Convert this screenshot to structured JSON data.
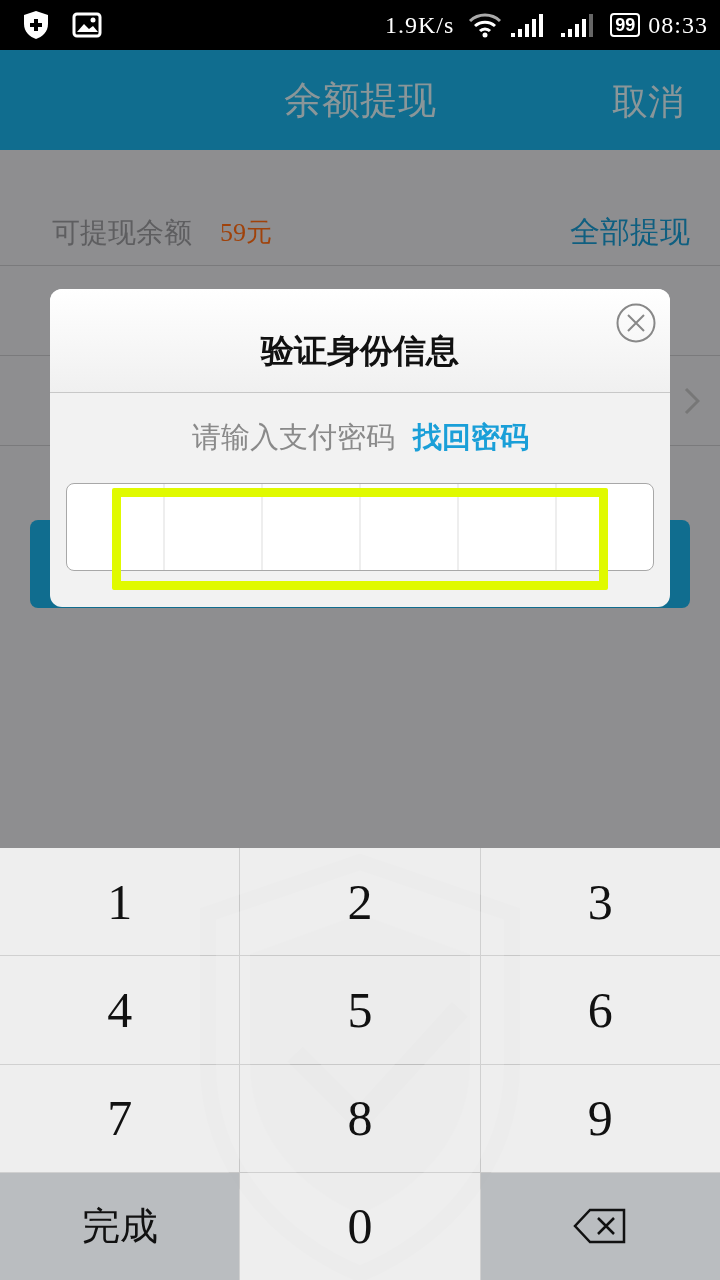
{
  "status_bar": {
    "speed": "1.9K/s",
    "battery": "99",
    "time": "08:33"
  },
  "header": {
    "title": "余额提现",
    "action": "取消"
  },
  "balance": {
    "label": "可提现余额",
    "amount": "59元",
    "action": "全部提现"
  },
  "rows": [
    {
      "chevron": false
    },
    {
      "chevron": true
    }
  ],
  "dialog": {
    "title": "验证身份信息",
    "prompt": "请输入支付密码",
    "link": "找回密码",
    "highlight_frame": true
  },
  "keypad": [
    {
      "kind": "digit",
      "label": "1"
    },
    {
      "kind": "digit",
      "label": "2"
    },
    {
      "kind": "digit",
      "label": "3"
    },
    {
      "kind": "digit",
      "label": "4"
    },
    {
      "kind": "digit",
      "label": "5"
    },
    {
      "kind": "digit",
      "label": "6"
    },
    {
      "kind": "digit",
      "label": "7"
    },
    {
      "kind": "digit",
      "label": "8"
    },
    {
      "kind": "digit",
      "label": "9"
    },
    {
      "kind": "action",
      "label": "完成"
    },
    {
      "kind": "digit",
      "label": "0"
    },
    {
      "kind": "backspace"
    }
  ]
}
